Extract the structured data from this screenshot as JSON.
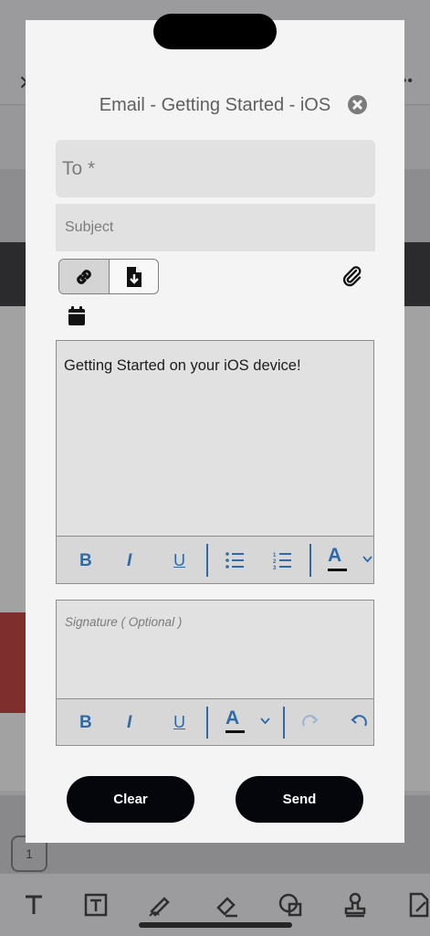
{
  "modal": {
    "title": "Email - Getting Started - iOS",
    "to_placeholder": "To *",
    "subject_placeholder": "Subject",
    "body_text": "Getting Started on your iOS device!",
    "signature_placeholder": "Signature ( Optional )",
    "clear_label": "Clear",
    "send_label": "Send"
  },
  "editor_toolbar": {
    "bold": "B",
    "italic": "I",
    "underline": "U",
    "text_color": "A"
  },
  "signature_toolbar": {
    "bold": "B",
    "italic": "I",
    "underline": "U",
    "text_color": "A"
  },
  "background": {
    "page_badge": "1"
  },
  "colors": {
    "accent": "#2f6aa6",
    "button": "#05060b",
    "field": "#e1e1e1"
  },
  "icons": [
    "close-icon",
    "link-icon",
    "download-file-icon",
    "paperclip-icon",
    "calendar-icon",
    "bulleted-list-icon",
    "numbered-list-icon",
    "chevron-down-icon",
    "redo-icon",
    "undo-icon"
  ]
}
